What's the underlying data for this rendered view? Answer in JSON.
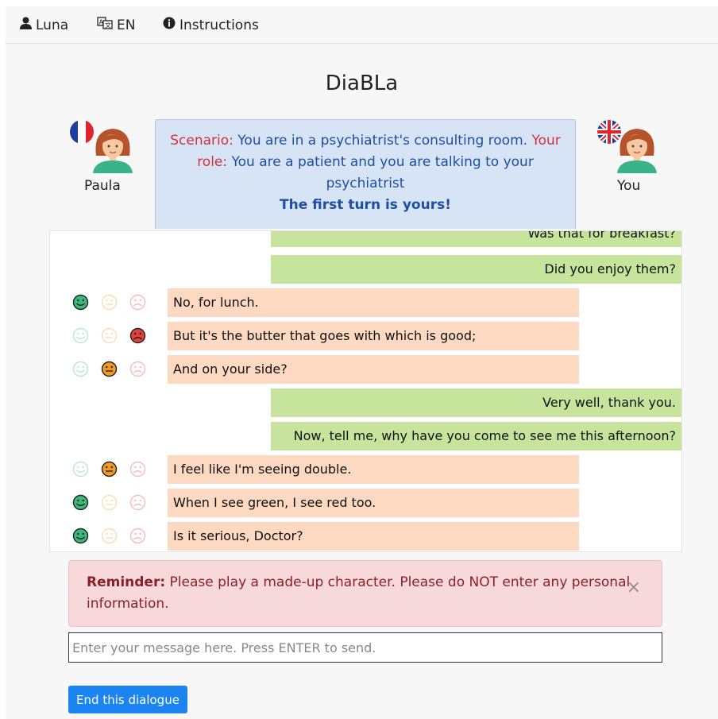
{
  "nav": {
    "user": "Luna",
    "language": "EN",
    "instructions": "Instructions"
  },
  "title": "DiaBLa",
  "partner": {
    "name": "Paula",
    "flag": "flag-france-icon"
  },
  "self": {
    "name": "You",
    "flag": "flag-uk-icon"
  },
  "scenario": {
    "scenario_label": "Scenario:",
    "scenario_text": " You are in a psychiatrist's consulting room.",
    "role_label": " Your role:",
    "role_text": " You are a patient and you are talking to your psychiatrist",
    "first_turn": "The first turn is yours!"
  },
  "messages": [
    {
      "from": "you",
      "text": "Was that for breakfast?"
    },
    {
      "from": "you",
      "text": "Did you enjoy them?"
    },
    {
      "from": "them",
      "text": "No, for lunch.",
      "rating": "good"
    },
    {
      "from": "them",
      "text": "But it's the butter that goes with which is good;",
      "rating": "bad"
    },
    {
      "from": "them",
      "text": "And on your side?",
      "rating": "neutral"
    },
    {
      "from": "you",
      "text": "Very well, thank you."
    },
    {
      "from": "you",
      "text": "Now, tell me, why have you come to see me this afternoon?"
    },
    {
      "from": "them",
      "text": "I feel like I'm seeing double.",
      "rating": "neutral"
    },
    {
      "from": "them",
      "text": "When I see green, I see red too.",
      "rating": "good"
    },
    {
      "from": "them",
      "text": "Is it serious, Doctor?",
      "rating": "good"
    }
  ],
  "reminder": {
    "label": "Reminder:",
    "text": " Please play a made-up character. Please do NOT enter any personal information.",
    "close": "×"
  },
  "input": {
    "placeholder": "Enter your message here. Press ENTER to send.",
    "value": ""
  },
  "end_button": "End this dialogue",
  "colors": {
    "you_bubble": "#c6e49b",
    "them_bubble": "#fcd9c0",
    "good": "#3cb878",
    "neutral": "#f39a22",
    "bad": "#e2413a",
    "button": "#1b84f0"
  }
}
